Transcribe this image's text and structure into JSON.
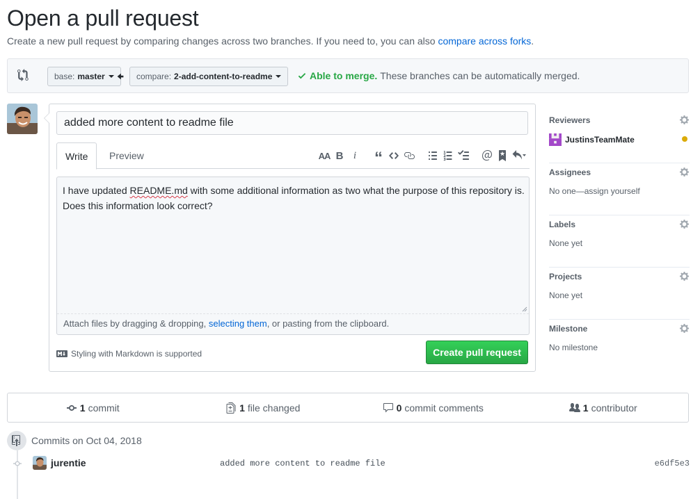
{
  "header": {
    "title": "Open a pull request",
    "subtitle": "Create a new pull request by comparing changes across two branches. If you need to, you can also",
    "subtitle_link": "compare across forks",
    "subtitle_end": "."
  },
  "range": {
    "base_prefix": "base:",
    "base_branch": "master",
    "compare_prefix": "compare:",
    "compare_branch": "2-add-content-to-readme",
    "merge_ok": "Able to merge.",
    "merge_text": "These branches can be automatically merged."
  },
  "compose": {
    "title_value": "added more content to readme file",
    "tabs": [
      "Write",
      "Preview"
    ],
    "body_prefix": "I have updated ",
    "body_misspelled": "README.md",
    "body_rest": " with some additional information as two what the purpose of this repository is.",
    "body_line2": "Does this information look correct?",
    "attach_prefix": "Attach files by dragging & dropping, ",
    "attach_link": "selecting them",
    "attach_suffix": ", or pasting from the clipboard.",
    "markdown_note": "Styling with Markdown is supported",
    "create_label": "Create pull request",
    "toolbar": {
      "header": "AA",
      "bold": "B",
      "italic": "i",
      "quote": "“"
    }
  },
  "sidebar": {
    "reviewers": {
      "heading": "Reviewers",
      "reviewer": "JustinsTeamMate"
    },
    "assignees": {
      "heading": "Assignees",
      "value": "No one—assign yourself"
    },
    "labels": {
      "heading": "Labels",
      "value": "None yet"
    },
    "projects": {
      "heading": "Projects",
      "value": "None yet"
    },
    "milestone": {
      "heading": "Milestone",
      "value": "No milestone"
    }
  },
  "summary": {
    "commits_count": "1",
    "commits_label": "commit",
    "files_count": "1",
    "files_label": "file changed",
    "comments_count": "0",
    "comments_label": "commit comments",
    "contributors_count": "1",
    "contributors_label": "contributor"
  },
  "commits": {
    "heading": "Commits on Oct 04, 2018",
    "items": [
      {
        "author": "jurentie",
        "message": "added more content to readme file",
        "sha": "e6df5e3"
      }
    ]
  },
  "colors": {
    "accent": "#0366d6",
    "success": "#28a745",
    "pending": "#dbab09",
    "reviewer_identicon": "#a348c9"
  }
}
